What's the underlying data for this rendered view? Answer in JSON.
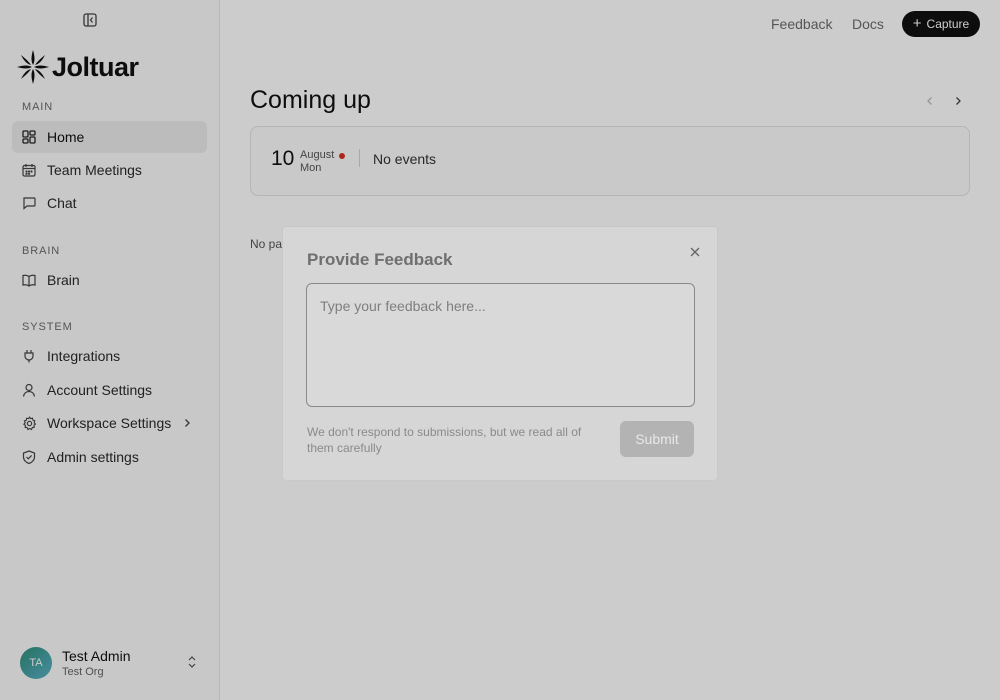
{
  "app": {
    "logo_text": "Joltuar"
  },
  "header": {
    "feedback_label": "Feedback",
    "docs_label": "Docs",
    "capture_label": "Capture"
  },
  "sidebar": {
    "sections": [
      {
        "label": "MAIN",
        "items": [
          {
            "label": "Home",
            "icon": "dashboard-icon",
            "active": true
          },
          {
            "label": "Team Meetings",
            "icon": "calendar-icon"
          },
          {
            "label": "Chat",
            "icon": "chat-icon"
          }
        ]
      },
      {
        "label": "BRAIN",
        "items": [
          {
            "label": "Brain",
            "icon": "book-icon"
          }
        ]
      },
      {
        "label": "SYSTEM",
        "items": [
          {
            "label": "Integrations",
            "icon": "plug-icon"
          },
          {
            "label": "Account Settings",
            "icon": "user-icon"
          },
          {
            "label": "Workspace Settings",
            "icon": "gear-icon",
            "has_submenu": true
          },
          {
            "label": "Admin settings",
            "icon": "shield-check-icon"
          }
        ]
      }
    ],
    "user": {
      "initials": "TA",
      "name": "Test Admin",
      "org": "Test Org"
    }
  },
  "main": {
    "title": "Coming up",
    "event": {
      "day": "10",
      "month": "August",
      "weekday": "Mon",
      "status": "No events"
    },
    "past_meetings": "No past meetings."
  },
  "modal": {
    "title": "Provide Feedback",
    "placeholder": "Type your feedback here...",
    "value": "",
    "note": "We don't respond to submissions, but we read all of them carefully",
    "submit_label": "Submit"
  },
  "colors": {
    "accent": "#111111",
    "event_dot": "#d93025",
    "overlay": "rgba(0,0,0,0.2)"
  }
}
